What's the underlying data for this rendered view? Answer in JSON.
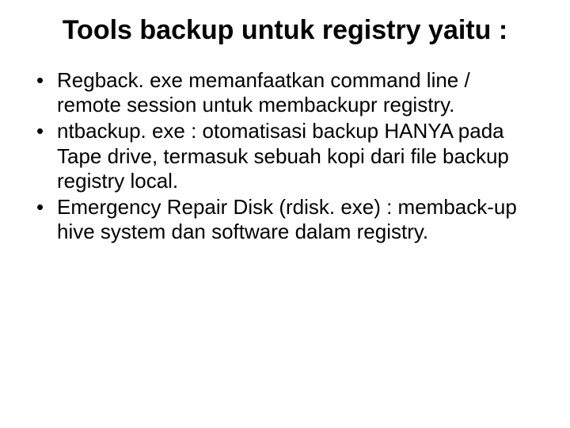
{
  "slide": {
    "title": "Tools backup untuk registry yaitu  :",
    "bullets": [
      "Regback. exe memanfaatkan command line / remote session untuk membackupr registry.",
      "ntbackup. exe : otomatisasi backup HANYA pada Tape drive, termasuk sebuah kopi dari file backup registry local.",
      "Emergency Repair Disk (rdisk. exe) : memback-up hive system dan software dalam registry."
    ]
  }
}
